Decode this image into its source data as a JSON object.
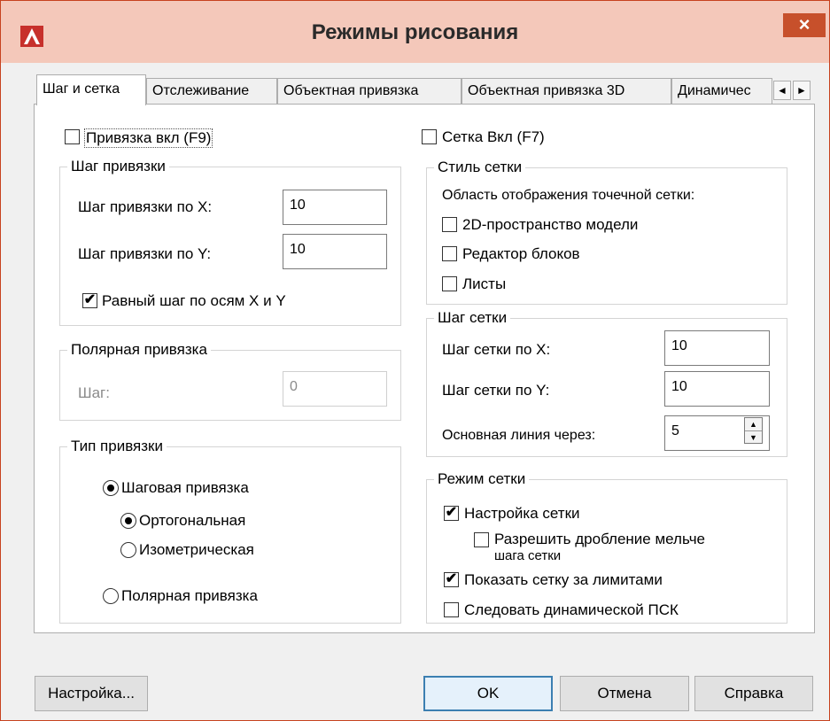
{
  "window": {
    "title": "Режимы рисования",
    "close_symbol": "×",
    "app_icon": "autocad-logo-icon",
    "accent_color": "#c7421f"
  },
  "tabs": [
    {
      "label": "Шаг и сетка",
      "active": true
    },
    {
      "label": "Отслеживание",
      "active": false
    },
    {
      "label": "Объектная привязка",
      "active": false
    },
    {
      "label": "Объектная привязка 3D",
      "active": false
    },
    {
      "label": "Динамичес",
      "active": false
    }
  ],
  "tab_scroll": {
    "left": "◄",
    "right": "►"
  },
  "snap": {
    "enable_label": "Привязка вкл (F9)",
    "enabled": false,
    "spacing_group": {
      "title": "Шаг привязки",
      "x_label": "Шаг привязки по X:",
      "x_value": "10",
      "y_label": "Шаг привязки по Y:",
      "y_value": "10",
      "equal_label": "Равный шаг по осям X и Y",
      "equal_checked": true
    },
    "polar_group": {
      "title": "Полярная привязка",
      "step_label": "Шаг:",
      "step_value": "0"
    },
    "type_group": {
      "title": "Тип привязки",
      "grid_snap": "Шаговая привязка",
      "rectangular": "Ортогональная",
      "isometric": "Изометрическая",
      "polar": "Полярная привязка",
      "selected_type": "Шаговая привязка",
      "selected_style": "Ортогональная"
    }
  },
  "grid": {
    "enable_label": "Сетка Вкл (F7)",
    "enabled": false,
    "style_group": {
      "title": "Стиль сетки",
      "caption": "Область отображения точечной сетки:",
      "model_space": "2D-пространство модели",
      "block_editor": "Редактор блоков",
      "sheets": "Листы",
      "model_space_checked": false,
      "block_editor_checked": false,
      "sheets_checked": false
    },
    "spacing_group": {
      "title": "Шаг сетки",
      "x_label": "Шаг сетки по X:",
      "x_value": "10",
      "y_label": "Шаг сетки по Y:",
      "y_value": "10",
      "major_label": "Основная линия через:",
      "major_value": "5"
    },
    "behavior_group": {
      "title": "Режим сетки",
      "adaptive": "Настройка сетки",
      "adaptive_checked": true,
      "subdivide": "Разрешить дробление мельче",
      "subdivide_line2": "шага сетки",
      "subdivide_checked": false,
      "beyond_limits": "Показать сетку за лимитами",
      "beyond_limits_checked": true,
      "follow_ucs": "Следовать динамической ПСК",
      "follow_ucs_checked": false
    }
  },
  "buttons": {
    "options": "Настройка...",
    "ok": "OK",
    "cancel": "Отмена",
    "help": "Справка"
  }
}
